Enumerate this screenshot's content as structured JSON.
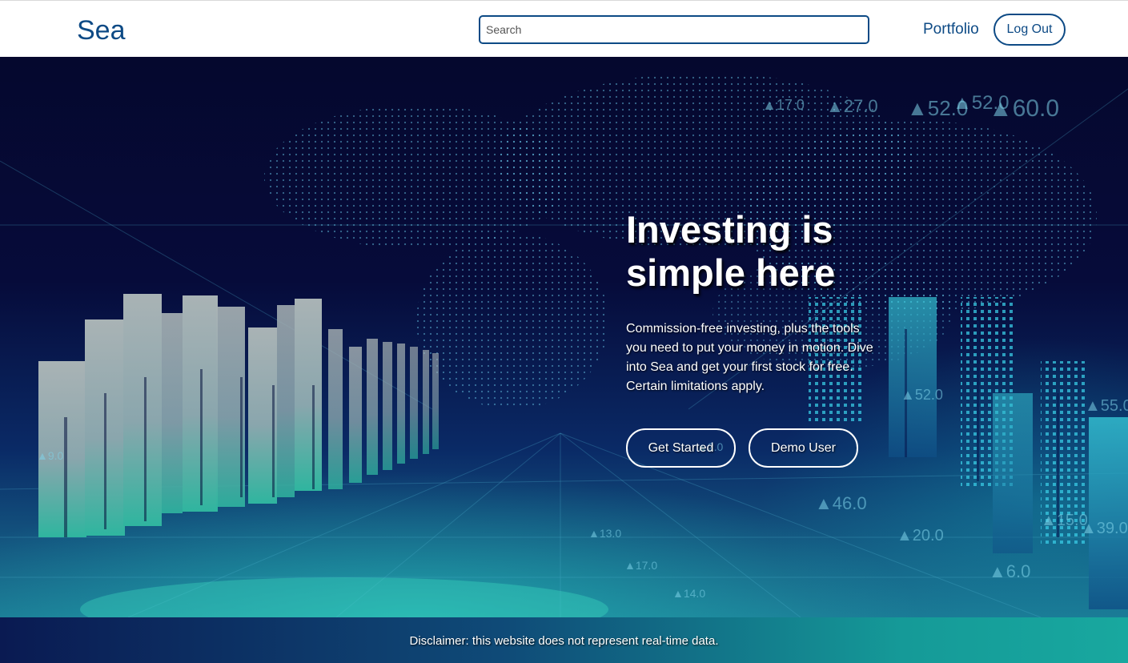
{
  "nav": {
    "logo": "Sea",
    "search_placeholder": "Search",
    "search_value": "",
    "portfolio_label": "Portfolio",
    "logout_label": "Log Out"
  },
  "hero": {
    "title": "Investing is simple here",
    "description": "Commission-free investing, plus the tools you need to put your money in motion. Dive into Sea and get your first stock for free. Certain limitations apply.",
    "get_started_label": "Get Started",
    "demo_user_label": "Demo User",
    "background": "stock-market-graphics",
    "background_labels": [
      "▲52.0",
      "▲17.0",
      "▲27.0",
      "▲52.0",
      "▲60.0",
      "▲9.0",
      "▲2.0",
      "▲52.0",
      "▲55.0",
      "▲46.0",
      "▲20.0",
      "▲6.0",
      "▲15.0",
      "▲39.0",
      "▲17.0",
      "▲14.0",
      "▲13.0"
    ]
  },
  "footer": {
    "disclaimer": "Disclaimer: this website does not represent real-time data."
  },
  "colors": {
    "brand": "#0d4a85",
    "hero_dark": "#05082e",
    "accent_teal": "#18a89f"
  }
}
